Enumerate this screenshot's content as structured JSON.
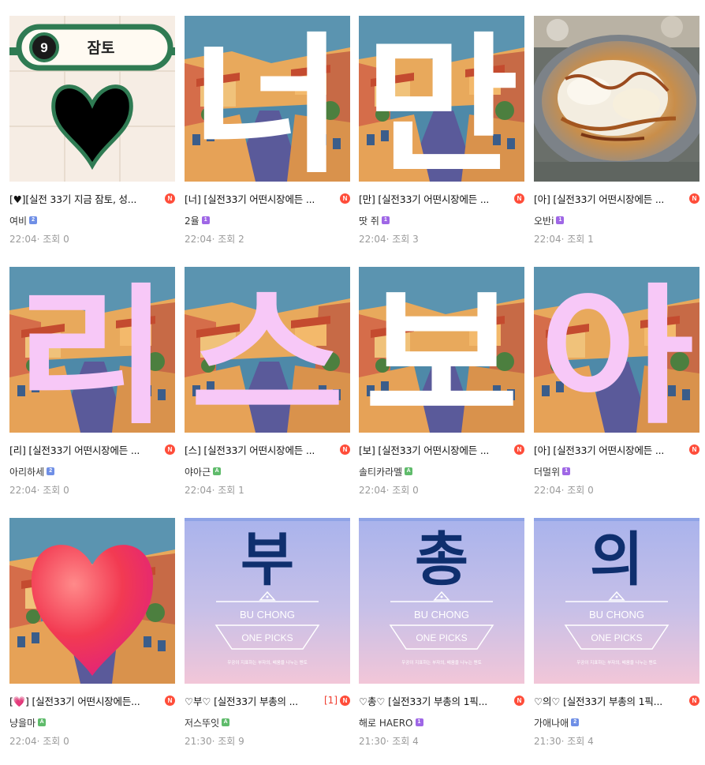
{
  "colors": {
    "new_badge": "#ff4d3a",
    "comment_count": "#ef3b2d",
    "meta_text": "#9a9a9a",
    "level_1_badge": "#9f67e6",
    "level_2_badge": "#6f8fe6",
    "level_a_badge": "#5fbb6b",
    "pink_glyph": "#f7c8f7",
    "navy_glyph": "#0f2f6e"
  },
  "new_badge_label": "N",
  "posts": [
    {
      "title": "[♥][실전 33기 지금 잠토, 성...",
      "author": "여비",
      "badge": "2",
      "time": "22:04",
      "views_label": "조회 0",
      "thumb": "station",
      "station_number": "9",
      "station_name": "잠토"
    },
    {
      "title": "[너] [실전33기 어떤시장에든 ...",
      "author": "2율",
      "badge": "1",
      "time": "22:04",
      "views_label": "조회 2",
      "thumb": "street",
      "glyph": "너",
      "glyph_color": "white"
    },
    {
      "title": "[만] [실전33기 어떤시장에든 ...",
      "author": "땃 쥐",
      "badge": "1",
      "time": "22:04",
      "views_label": "조회 3",
      "thumb": "street",
      "glyph": "만",
      "glyph_color": "white"
    },
    {
      "title": "[아] [실전33기 어떤시장에든 ...",
      "author": "오반i",
      "badge": "1",
      "time": "22:04",
      "views_label": "조회 1",
      "thumb": "food"
    },
    {
      "title": "[리] [실전33기 어떤시장에든 ...",
      "author": "아리하세",
      "badge": "2",
      "time": "22:04",
      "views_label": "조회 0",
      "thumb": "street",
      "glyph": "리",
      "glyph_color": "pink"
    },
    {
      "title": "[스] [실전33기 어떤시장에든 ...",
      "author": "야아근",
      "badge": "A",
      "time": "22:04",
      "views_label": "조회 1",
      "thumb": "street",
      "glyph": "스",
      "glyph_color": "pink"
    },
    {
      "title": "[보] [실전33기 어떤시장에든 ...",
      "author": "솔티카라멜",
      "badge": "A",
      "time": "22:04",
      "views_label": "조회 0",
      "thumb": "street",
      "glyph": "보",
      "glyph_color": "white"
    },
    {
      "title": "[아] [실전33기 어떤시장에든 ...",
      "author": "더멀위",
      "badge": "1",
      "time": "22:04",
      "views_label": "조회 0",
      "thumb": "street",
      "glyph": "아",
      "glyph_color": "pink"
    },
    {
      "title": "[💗] [실전33기 어떤시장에든...",
      "author": "냥을마",
      "badge": "A",
      "time": "22:04",
      "views_label": "조회 0",
      "thumb": "heart-street"
    },
    {
      "title": "♡부♡ [실전33기 부총의 ...",
      "comment_count": "[1]",
      "author": "저스뚜잇",
      "badge": "A",
      "time": "21:30",
      "views_label": "조회 9",
      "thumb": "buchong",
      "glyph": "부",
      "brand": "BU CHONG",
      "picks": "ONE PICKS",
      "tagline": "우공이 지표하는 부자의, 배움을 나누는 멘토"
    },
    {
      "title": "♡총♡ [실전33기 부총의 1픽...",
      "author": "해로 HAERO",
      "badge": "1",
      "time": "21:30",
      "views_label": "조회 4",
      "thumb": "buchong",
      "glyph": "총",
      "brand": "BU CHONG",
      "picks": "ONE PICKS",
      "tagline": "우공이 지표하는 부자의, 배움을 나누는 멘토"
    },
    {
      "title": "♡의♡ [실전33기 부총의 1픽...",
      "author": "가애나애",
      "badge": "2",
      "time": "21:30",
      "views_label": "조회 4",
      "thumb": "buchong",
      "glyph": "의",
      "brand": "BU CHONG",
      "picks": "ONE PICKS",
      "tagline": "우공이 지표하는 부자의, 배움을 나누는 멘토"
    }
  ]
}
